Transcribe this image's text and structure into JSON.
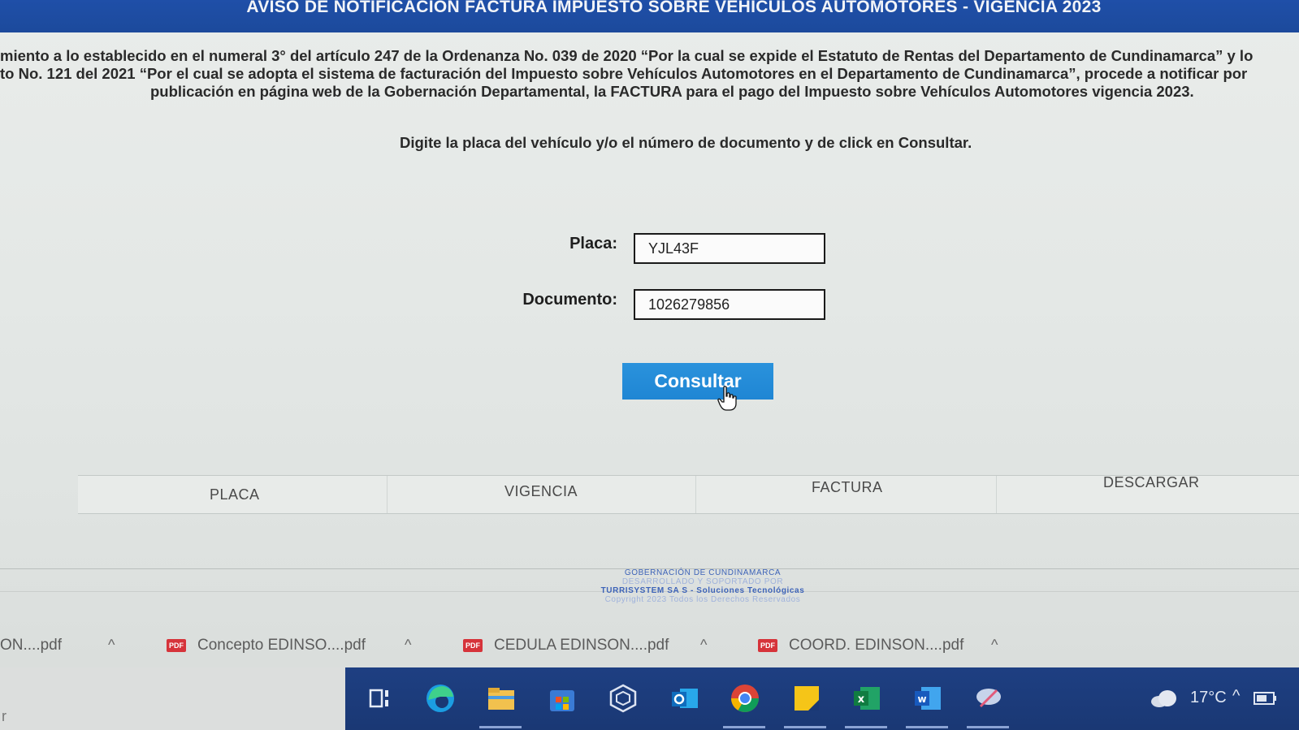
{
  "banner": {
    "title": "AVISO DE NOTIFICACIÓN FACTURA IMPUESTO SOBRE VEHÍCULOS AUTOMOTORES - VIGENCIA 2023"
  },
  "notice": {
    "line1": "miento a lo establecido en el numeral 3° del artículo 247 de la Ordenanza No. 039 de 2020 “Por la cual se expide el Estatuto de Rentas del Departamento de Cundinamarca” y lo",
    "line2": "to No. 121 del 2021 “Por el cual se adopta el sistema de facturación del Impuesto sobre Vehículos Automotores en el Departamento de Cundinamarca”, procede a notificar por",
    "line3": "publicación en página web de la Gobernación Departamental, la FACTURA para el pago del Impuesto sobre Vehículos Automotores vigencia 2023."
  },
  "instruction": "Digite la placa del vehículo y/o el número de documento y de click en Consultar.",
  "form": {
    "placa_label": "Placa:",
    "placa_value": "YJL43F",
    "documento_label": "Documento:",
    "documento_value": "1026279856",
    "consultar_label": "Consultar"
  },
  "table": {
    "columns": [
      "PLACA",
      "VIGENCIA",
      "FACTURA",
      "DESCARGAR"
    ]
  },
  "footer": {
    "line1": "GOBERNACIÓN DE CUNDINAMARCA",
    "line2": "DESARROLLADO Y SOPORTADO POR",
    "line3": "TURRISYSTEM SA S - Soluciones Tecnológicas",
    "line4": "Copyright 2023 Todos los Derechos Reservados"
  },
  "downloads": [
    {
      "name": "ON....pdf"
    },
    {
      "name": "Concepto EDINSO....pdf"
    },
    {
      "name": "CEDULA EDINSON....pdf"
    },
    {
      "name": "COORD. EDINSON....pdf"
    }
  ],
  "download_badge": "PDF",
  "taskbar": {
    "left_fragment": "r",
    "temperature": "17°C",
    "icons": [
      "task-view-icon",
      "edge-icon",
      "file-explorer-icon",
      "store-icon",
      "cube-app-icon",
      "outlook-icon",
      "chrome-icon",
      "sticky-notes-icon",
      "excel-icon",
      "word-icon",
      "snip-icon"
    ]
  },
  "colors": {
    "banner": "#1f4fa8",
    "button": "#1f86d4",
    "taskbar": "#1e3f82",
    "pdf_badge": "#d6333a"
  }
}
